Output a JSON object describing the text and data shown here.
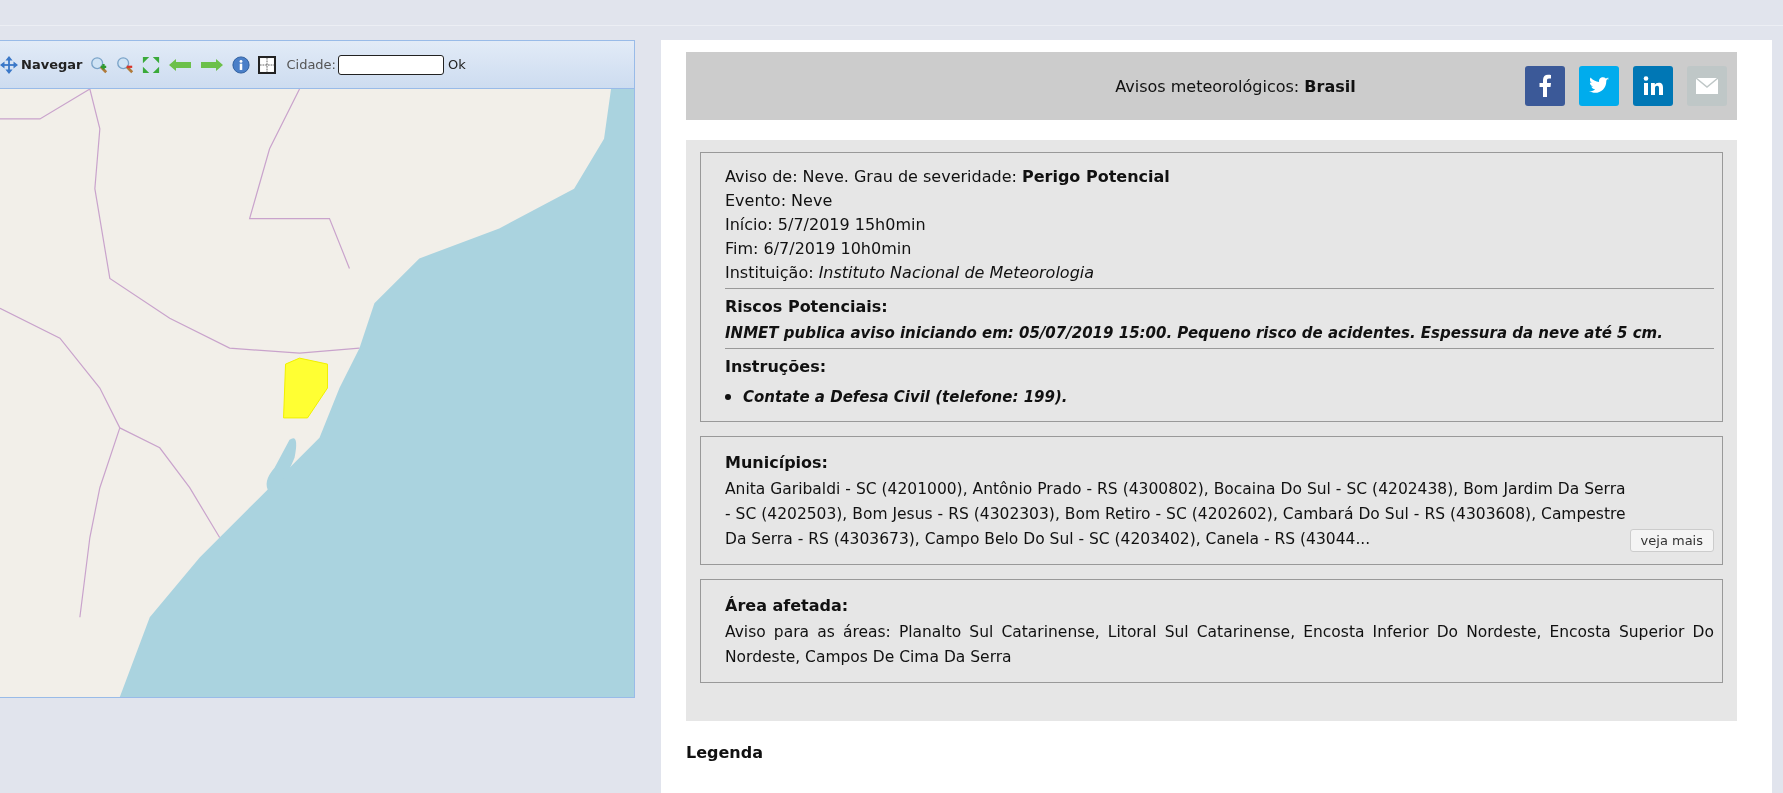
{
  "toolbar": {
    "navigate_label": "Navegar",
    "city_label": "Cidade:",
    "ok_label": "Ok"
  },
  "header": {
    "title": "Avisos meteorológicos: **Brasil**"
  },
  "alert": {
    "lines": [
      "Aviso de: Neve. Grau de severidade: **Perigo Potencial**",
      "Evento: Neve",
      "Início: 5/7/2019 15h0min",
      "Fim: 6/7/2019 10h0min",
      "Instituição: *Instituto Nacional de Meteorologia*"
    ],
    "risks_heading": "Riscos Potenciais:",
    "risks_text": "INMET publica aviso iniciando em: 05/07/2019 15:00. Pequeno risco de acidentes. Espessura da neve até 5 cm.",
    "instructions_heading": "Instruções:",
    "instructions": [
      "Contate a Defesa Civil (telefone: 199)."
    ]
  },
  "municipalities": {
    "heading": "Municípios:",
    "text": "Anita Garibaldi - SC (4201000), Antônio Prado - RS (4300802), Bocaina Do Sul - SC (4202438), Bom Jardim Da Serra - SC (4202503), Bom Jesus - RS (4302303), Bom Retiro - SC (4202602), Cambará Do Sul - RS (4303608), Campestre Da Serra - RS (4303673), Campo Belo Do Sul - SC (4203402), Canela - RS (43044...",
    "more_button": "veja mais"
  },
  "affected_area": {
    "heading": "Área afetada:",
    "text": "Aviso para as áreas: Planalto Sul Catarinense, Litoral Sul Catarinense, Encosta Inferior Do Nordeste, Encosta Superior Do Nordeste, Campos De Cima Da Serra"
  },
  "legend": {
    "heading": "Legenda"
  }
}
